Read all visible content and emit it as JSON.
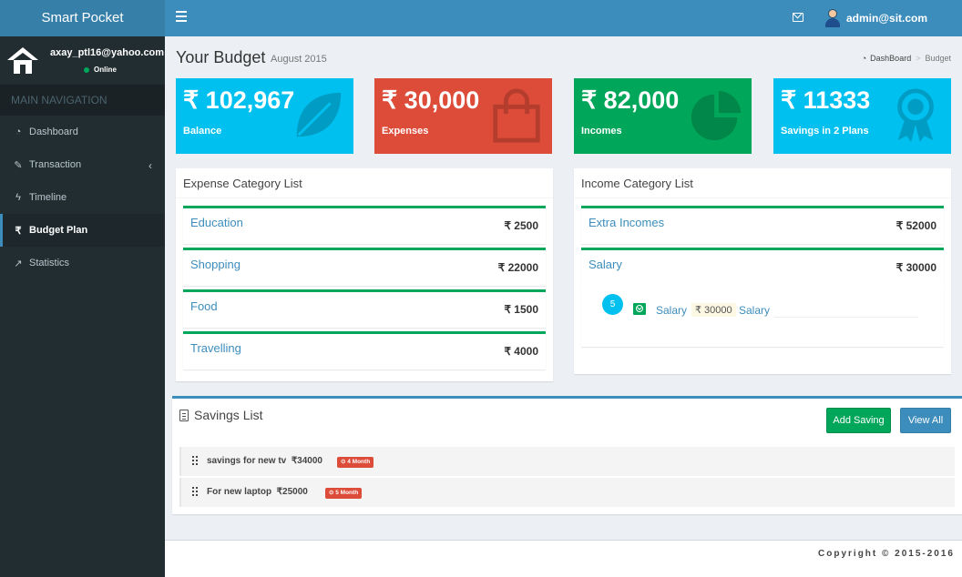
{
  "app": {
    "title": "Smart Pocket"
  },
  "header": {
    "user_name": "admin@sit.com"
  },
  "sidebar": {
    "user_email": "axay_ptl16@yahoo.com",
    "status": "Online",
    "nav_header": "MAIN NAVIGATION",
    "items": [
      {
        "label": "Dashboard",
        "icon": "dashboard-icon",
        "glyph": "◔"
      },
      {
        "label": "Transaction",
        "icon": "pencil-icon",
        "glyph": "✎"
      },
      {
        "label": "Timeline",
        "icon": "bolt-icon",
        "glyph": "ϟ"
      },
      {
        "label": "Budget Plan",
        "icon": "rupee-icon",
        "glyph": "₹"
      },
      {
        "label": "Statistics",
        "icon": "line-chart-icon",
        "glyph": "↗"
      }
    ],
    "chevron": "‹"
  },
  "page": {
    "title": "Your Budget",
    "subtitle": "August 2015",
    "breadcrumb": {
      "home": "DashBoard",
      "separator": ">",
      "current": "Budget"
    }
  },
  "infoboxes": {
    "balance": {
      "amount": "₹ 102,967",
      "label": "Balance",
      "color": "#00c0ef"
    },
    "expenses": {
      "amount": "₹ 30,000",
      "label": "Expenses",
      "color": "#dd4b39"
    },
    "incomes": {
      "amount": "₹ 82,000",
      "label": "Incomes",
      "color": "#00a65a"
    },
    "savings": {
      "amount": "₹ 11333",
      "label": "Savings in 2 Plans",
      "color": "#00c0ef"
    }
  },
  "expense_categories": {
    "title": "Expense Category List",
    "items": [
      {
        "name": "Education",
        "amount": "₹ 2500"
      },
      {
        "name": "Shopping",
        "amount": "₹ 22000"
      },
      {
        "name": "Food",
        "amount": "₹ 1500"
      },
      {
        "name": "Travelling",
        "amount": "₹ 4000"
      }
    ]
  },
  "income_categories": {
    "title": "Income Category List",
    "items": [
      {
        "name": "Extra Incomes",
        "amount": "₹ 52000"
      },
      {
        "name": "Salary",
        "amount": "₹ 30000"
      }
    ],
    "expanded": {
      "badge": "5",
      "name": "Salary",
      "amount": "₹ 30000",
      "description": "Salary"
    }
  },
  "savings": {
    "title": "Savings List",
    "add_button": "Add Saving",
    "view_button": "View All",
    "items": [
      {
        "name": "savings for new tv",
        "amount": "₹34000",
        "label": "⊙ 4 Month"
      },
      {
        "name": "For new laptop",
        "amount": "₹25000",
        "label": "⊙ 5 Month"
      }
    ]
  },
  "footer": {
    "text": "Copyright © 2015-2016"
  }
}
